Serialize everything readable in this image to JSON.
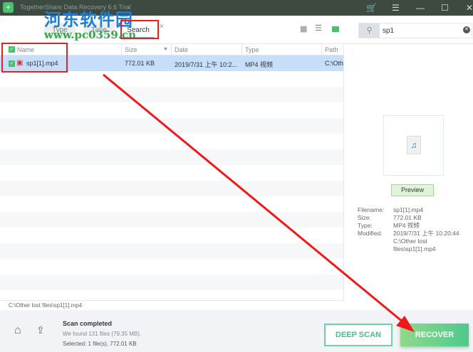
{
  "app": {
    "title": "TogetherShare Data Recovery 6.6 Trial"
  },
  "watermark": {
    "cn": "河东软件园",
    "url": "www.pc0359.cn"
  },
  "tabs": [
    {
      "label": "Type"
    },
    {
      "label": "Time"
    },
    {
      "label": "Search"
    }
  ],
  "search": {
    "value": "sp1"
  },
  "columns": [
    "Name",
    "Size",
    "Date",
    "Type",
    "Path"
  ],
  "rows": [
    {
      "name": "sp1[1].mp4",
      "size": "772.01 KB",
      "date": "2019/7/31 上午 10:2...",
      "type": "MP4 视频",
      "path": "C:\\Oth"
    }
  ],
  "path_bar": "C:\\Other lost files\\sp1[1].mp4",
  "details": {
    "preview_label": "Preview",
    "filename_label": "Filename:",
    "filename": "sp1[1].mp4",
    "size_label": "Size:",
    "size": "772.01 KB",
    "type_label": "Type:",
    "type": "MP4 视频",
    "modified_label": "Modified:",
    "modified": "2019/7/31 上午 10:20:44",
    "path1": "C:\\Other lost",
    "path2": "files\\sp1[1].mp4"
  },
  "status": {
    "title": "Scan completed",
    "found": "We found 131 files (79.35 MB).",
    "selected": "Selected: 1 file(s), 772.01 KB"
  },
  "buttons": {
    "deep_scan": "DEEP SCAN",
    "recover": "RECOVER"
  }
}
